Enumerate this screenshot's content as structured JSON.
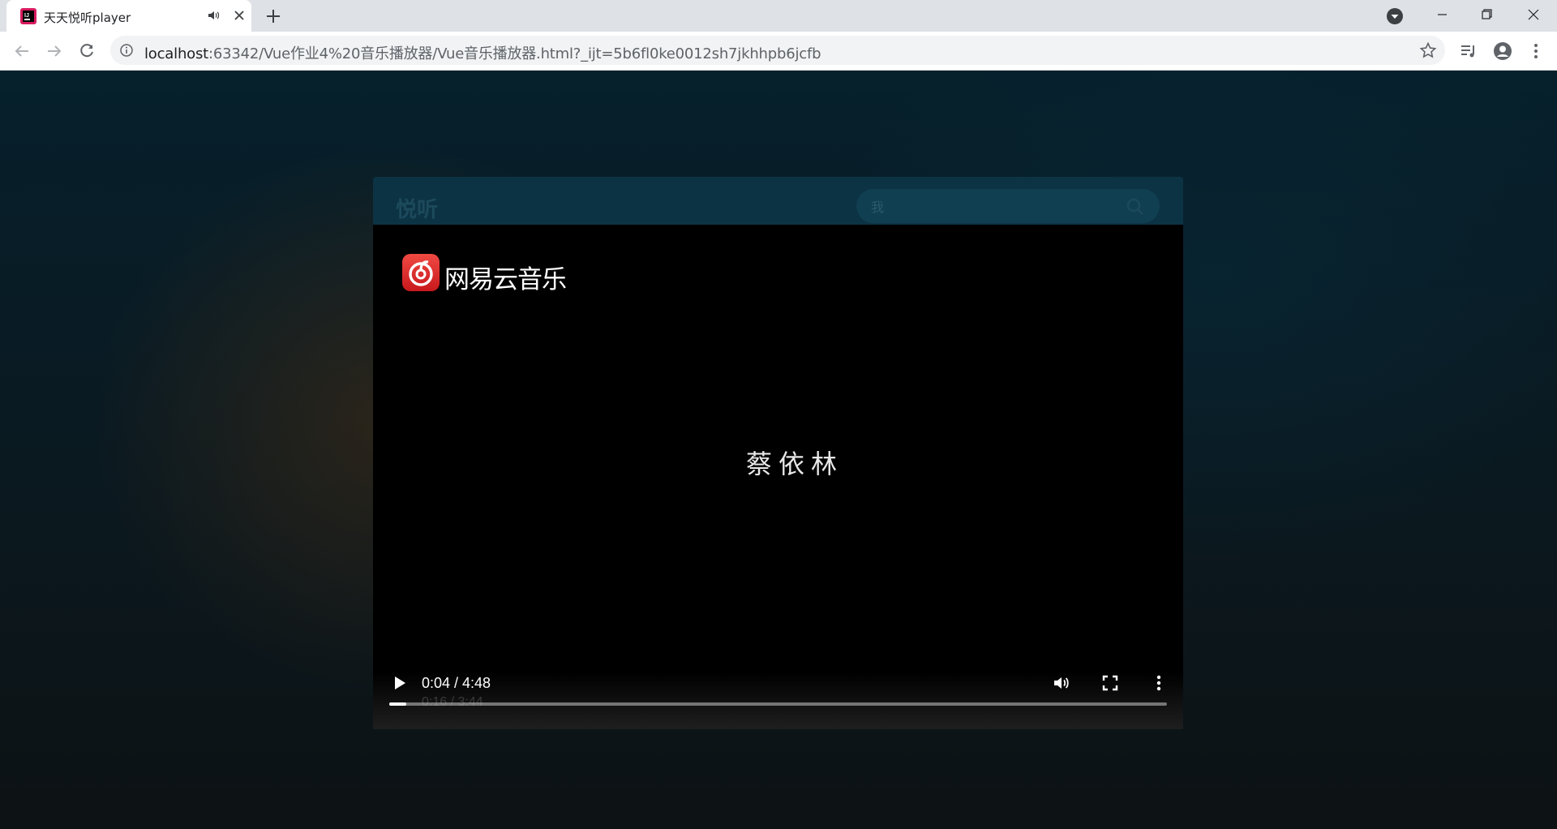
{
  "browser": {
    "tab": {
      "title": "天天悦听player",
      "favicon": "jetbrains-icon",
      "audio_icon": "speaker-icon",
      "close_icon": "close-icon"
    },
    "new_tab_icon": "plus-icon",
    "address": {
      "host": "localhost",
      "rest": ":63342/Vue作业4%20音乐播放器/Vue音乐播放器.html?_ijt=5b6fl0ke0012sh7jkhhpb6jcfb"
    }
  },
  "app": {
    "logo": "悦听",
    "search": {
      "value": "我"
    }
  },
  "video": {
    "brand_text": "网易云音乐",
    "artist": "蔡依林",
    "time_display": "0:04 / 4:48",
    "ghost_time": "0:16 / 3:44",
    "progress": 0.022
  },
  "colors": {
    "page_bg": "#0a1b24",
    "header_bg": "#0c3344",
    "brand_red": "#e0282c"
  }
}
